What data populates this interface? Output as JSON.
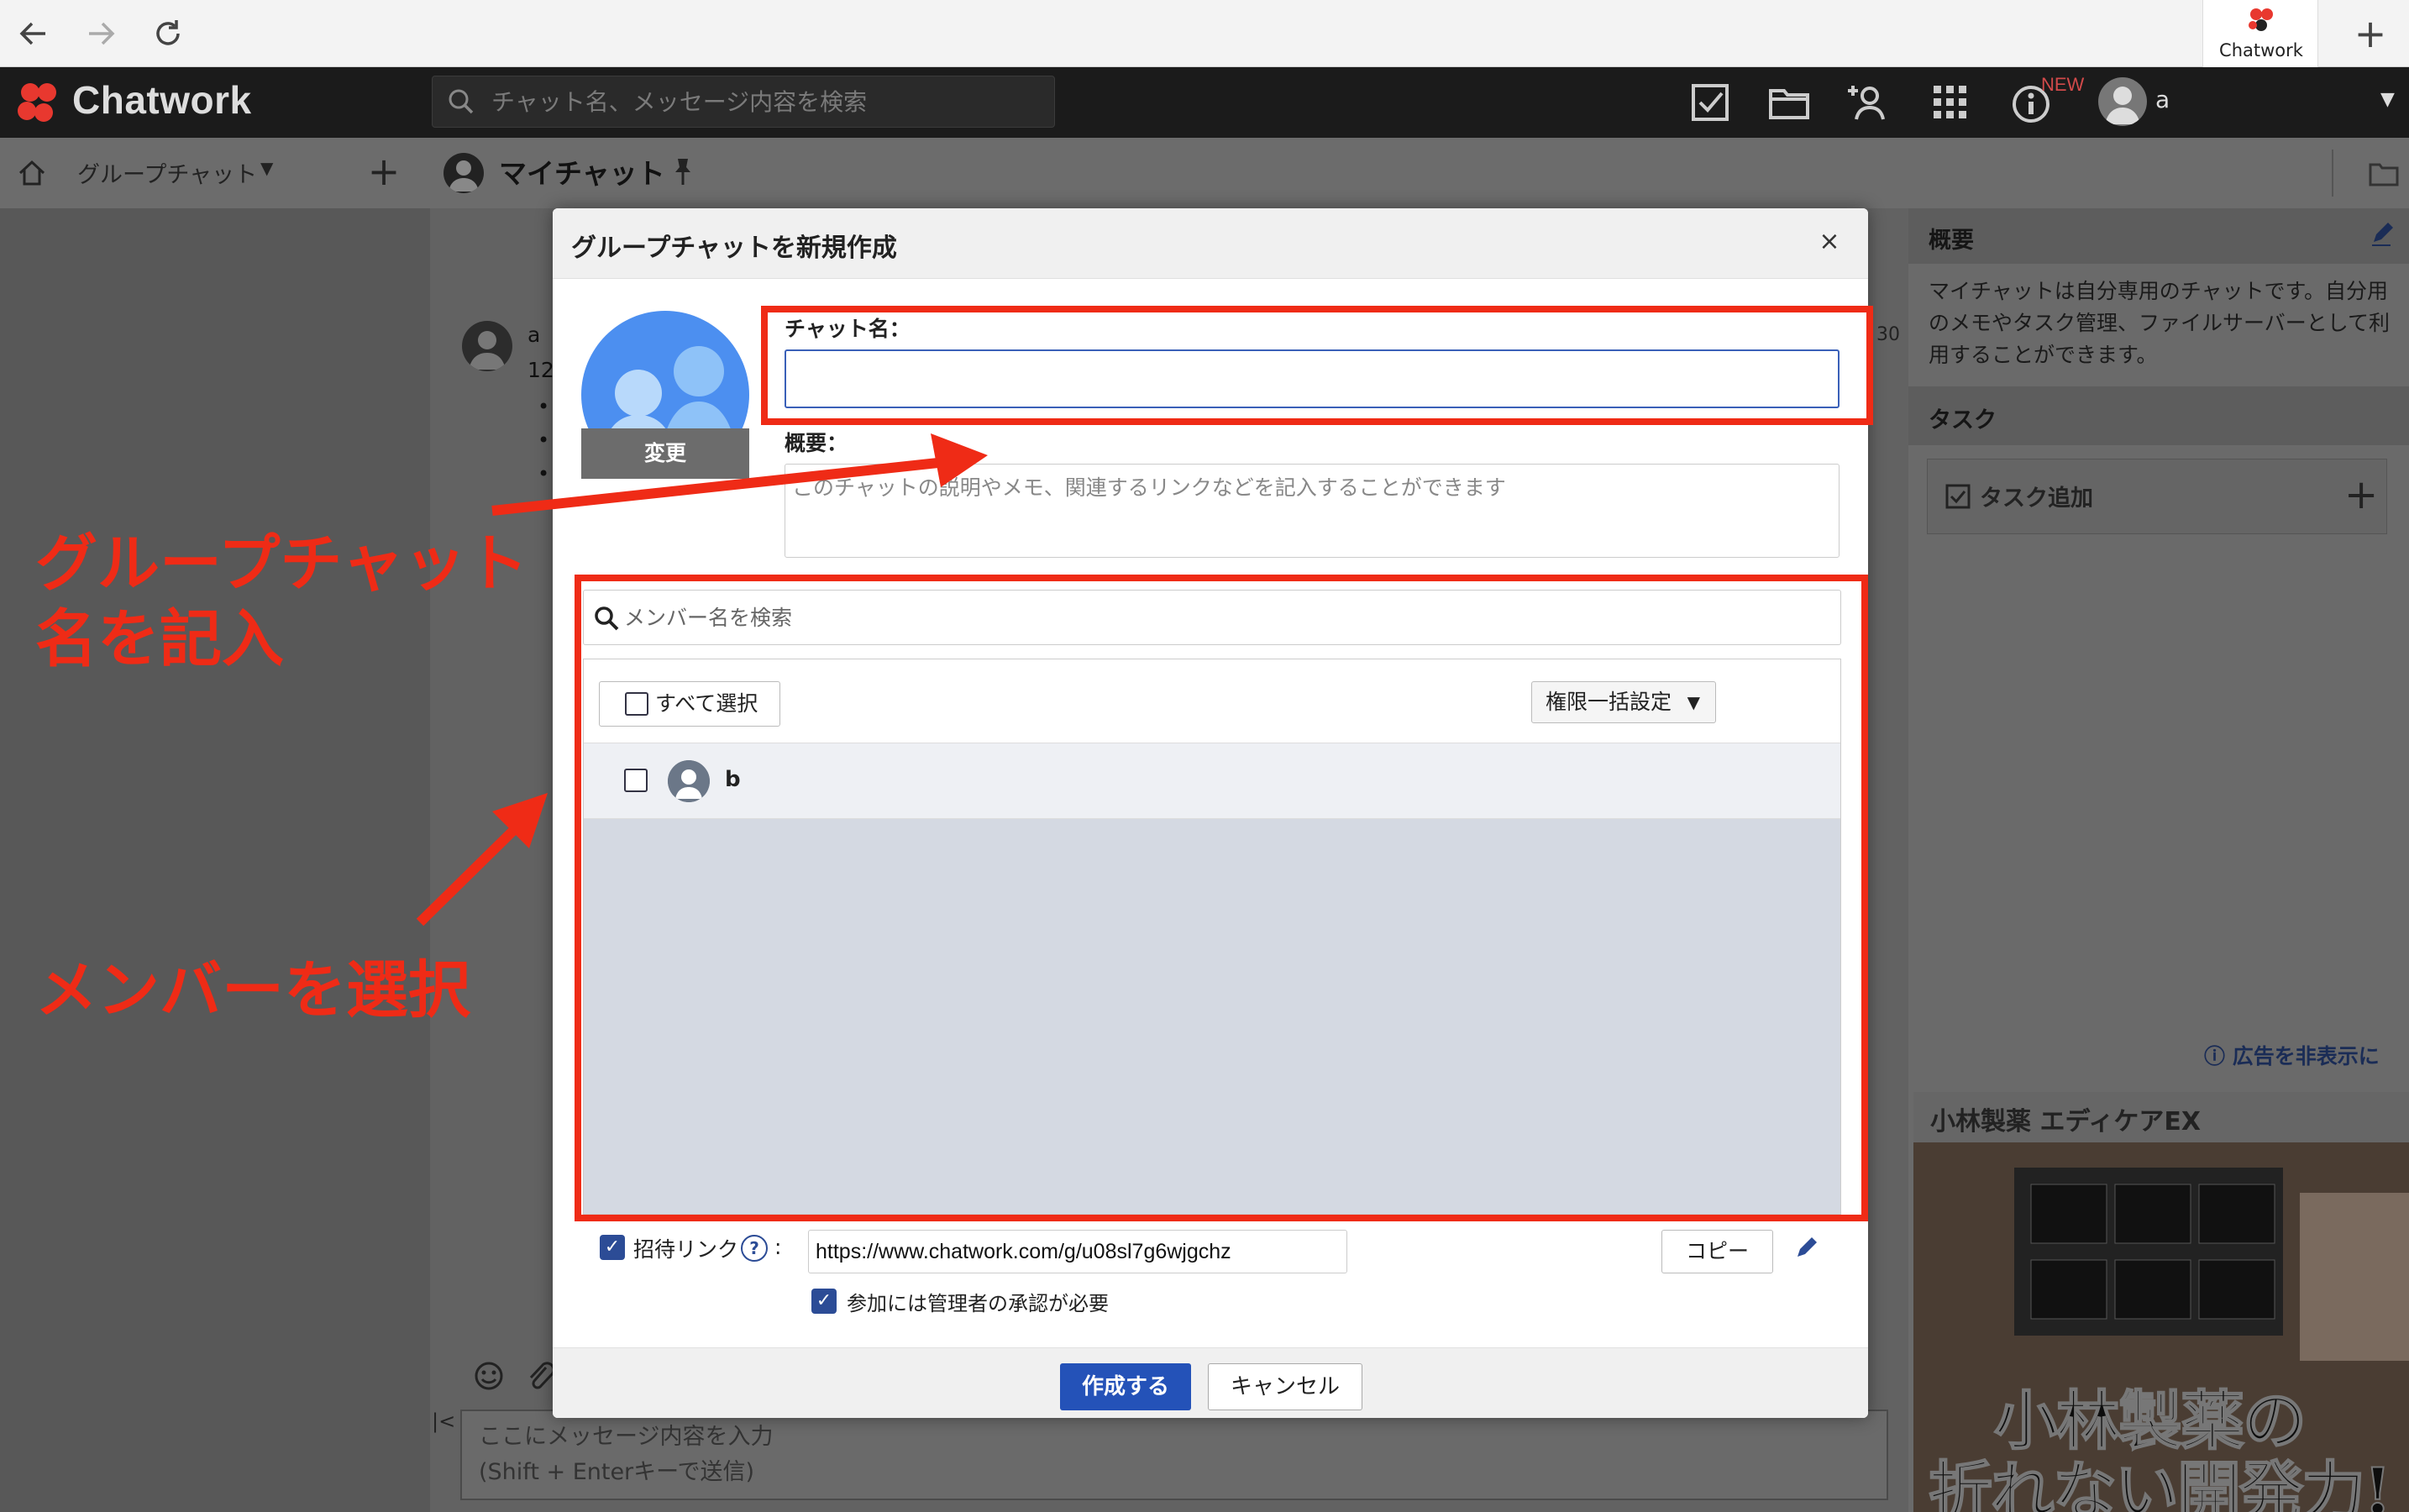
{
  "browser": {
    "tab_label": "Chatwork"
  },
  "app": {
    "logo_text": "Chatwork",
    "search_placeholder": "チャット名、メッセージ内容を検索",
    "new_badge": "NEW",
    "user_name": "a",
    "brand_colors": {
      "logo_red": "#e8382f",
      "accent_blue": "#2452b8",
      "annotation_red": "#ef2b16"
    }
  },
  "subheader": {
    "group_chat_label": "グループチャット",
    "room_title": "マイチャット"
  },
  "chat": {
    "msg_sender": "a",
    "msg_count": "12",
    "msg_time": "30",
    "compose_line1": "ここにメッセージ内容を入力",
    "compose_line2": "(Shift + Enterキーで送信)"
  },
  "right_panel": {
    "overview_label": "概要",
    "overview_text": "マイチャットは自分専用のチャットです。自分用のメモやタスク管理、ファイルサーバーとして利用することができます。",
    "task_label": "タスク",
    "task_add_label": "タスク追加",
    "ad_hide_link": "広告を非表示に",
    "ad_brand": "小林製薬 エディケアEX",
    "ad_headline1": "小林製薬の",
    "ad_headline2": "折れない開発力!"
  },
  "modal": {
    "title": "グループチャットを新規作成",
    "change_icon_label": "変更",
    "chat_name_label": "チャット名：",
    "chat_name_value": "",
    "overview_label": "概要：",
    "overview_placeholder": "このチャットの説明やメモ、関連するリンクなどを記入することができます",
    "member_search_placeholder": "メンバー名を検索",
    "select_all_label": "すべて選択",
    "bulk_permission_label": "権限一括設定",
    "members": [
      {
        "name": "b",
        "checked": false
      }
    ],
    "invite_link_label": "招待リンク",
    "invite_link_checked": true,
    "invite_link_value": "https://www.chatwork.com/g/u08sl7g6wjgchz",
    "copy_label": "コピー",
    "approval_label": "参加には管理者の承認が必要",
    "approval_checked": true,
    "create_label": "作成する",
    "cancel_label": "キャンセル"
  },
  "annotations": {
    "group_name_line1": "グループチャット",
    "group_name_line2": "名を記入",
    "members_text": "メンバーを選択"
  }
}
